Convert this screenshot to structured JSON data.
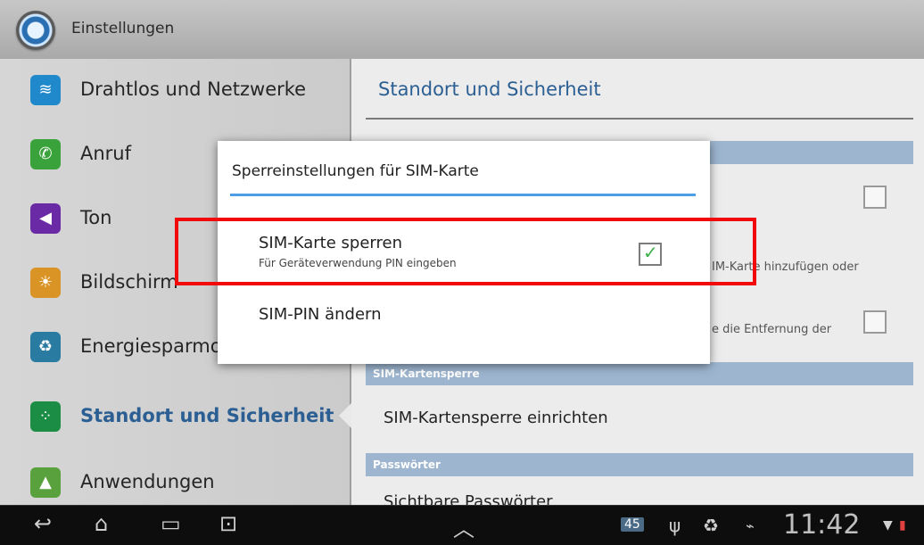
{
  "window": {
    "title": "Einstellungen"
  },
  "sidebar": {
    "items": [
      {
        "label": "Drahtlos und Netzwerke",
        "icon": "wifi-icon"
      },
      {
        "label": "Anruf",
        "icon": "phone-icon"
      },
      {
        "label": "Ton",
        "icon": "speaker-icon"
      },
      {
        "label": "Bildschirm",
        "icon": "brightness-icon"
      },
      {
        "label": "Energiesparmodus",
        "icon": "battery-recycle-icon"
      },
      {
        "label": "Standort und Sicherheit",
        "icon": "location-grid-icon",
        "active": true
      },
      {
        "label": "Anwendungen",
        "icon": "android-icon"
      }
    ]
  },
  "content": {
    "header": "Standort und Sicherheit",
    "partial_text_1": "IM-Karte hinzufügen oder",
    "partial_text_2": "e die Entfernung der",
    "section_simlock": "SIM-Kartensperre",
    "row_simlock": "SIM-Kartensperre einrichten",
    "section_passwords": "Passwörter",
    "row_visible_passwords": "Sichtbare Passwörter"
  },
  "dialog": {
    "title": "Sperreinstellungen für SIM-Karte",
    "option1_title": "SIM-Karte sperren",
    "option1_subtitle": "Für Geräteverwendung PIN eingeben",
    "option1_checked": true,
    "option2_title": "SIM-PIN ändern"
  },
  "statusbar": {
    "time": "11:42",
    "notification_badge": "45"
  },
  "colors": {
    "accent_blue": "#2b5f93",
    "section_blue": "#9db5cf",
    "highlight_red": "#f00a0a",
    "check_green": "#3cb04a"
  }
}
